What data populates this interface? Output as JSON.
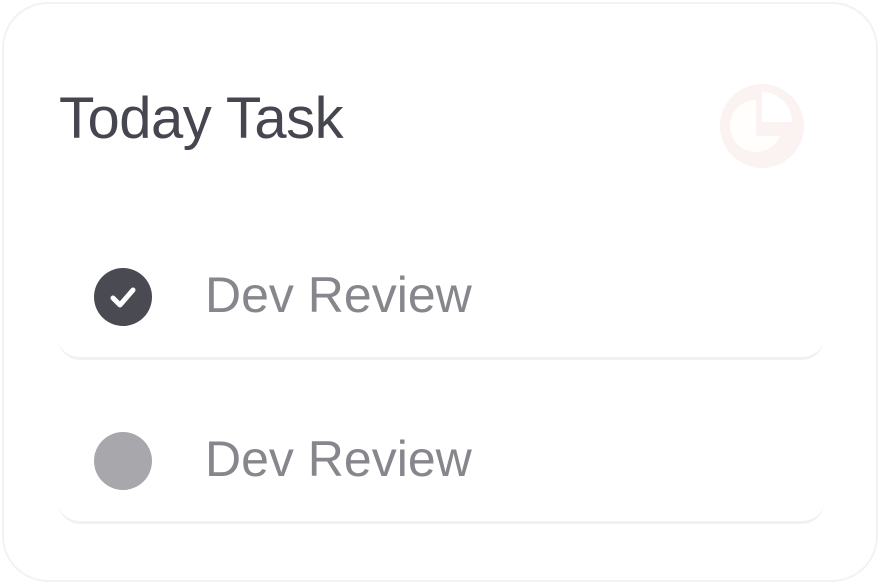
{
  "card": {
    "title": "Today Task",
    "action_icon": "pie-chart-icon"
  },
  "tasks": [
    {
      "label": "Dev Review",
      "completed": true,
      "status_icon": "check-circle-icon"
    },
    {
      "label": "Dev Review",
      "completed": false,
      "status_icon": "empty-circle-icon"
    }
  ],
  "colors": {
    "title": "#464650",
    "task_text": "#86868d",
    "checked_fill": "#4a4a53",
    "unchecked_fill": "#a7a7ac",
    "icon_bg": "#fbf3f1"
  }
}
